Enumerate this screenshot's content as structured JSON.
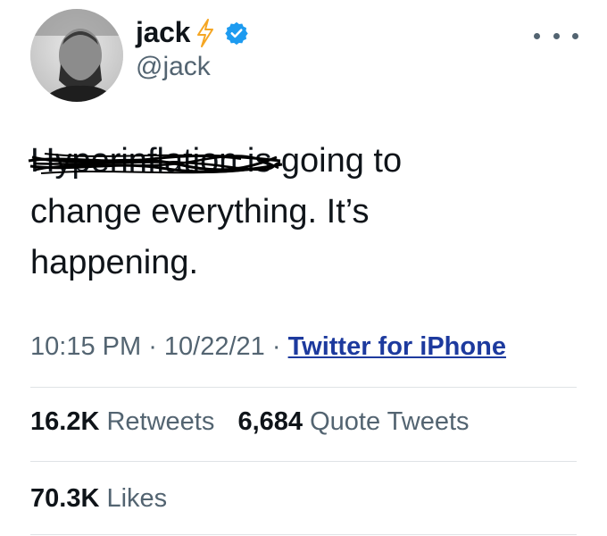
{
  "author": {
    "display_name": "jack",
    "handle": "@jack",
    "avatar_icon": "profile-photo"
  },
  "icons": {
    "bolt": "lightning-bolt-icon",
    "verified": "verified-badge-icon",
    "more": "more-options-icon"
  },
  "colors": {
    "bolt": "#f5a623",
    "verified": "#1d9bf0",
    "link": "#1d3a9e",
    "secondary_text": "#536471"
  },
  "tweet": {
    "struck_word": "Hyperinflation",
    "text_line1": " is going to",
    "text_line2": "change everything. It’s",
    "text_line3": "happening."
  },
  "meta": {
    "time": "10:15 PM",
    "sep1": " · ",
    "date": "10/22/21",
    "sep2": " · ",
    "source": "Twitter for iPhone"
  },
  "stats": {
    "retweets_count": "16.2K",
    "retweets_label": "Retweets",
    "quotes_count": "6,684",
    "quotes_label": "Quote Tweets",
    "likes_count": "70.3K",
    "likes_label": "Likes"
  }
}
